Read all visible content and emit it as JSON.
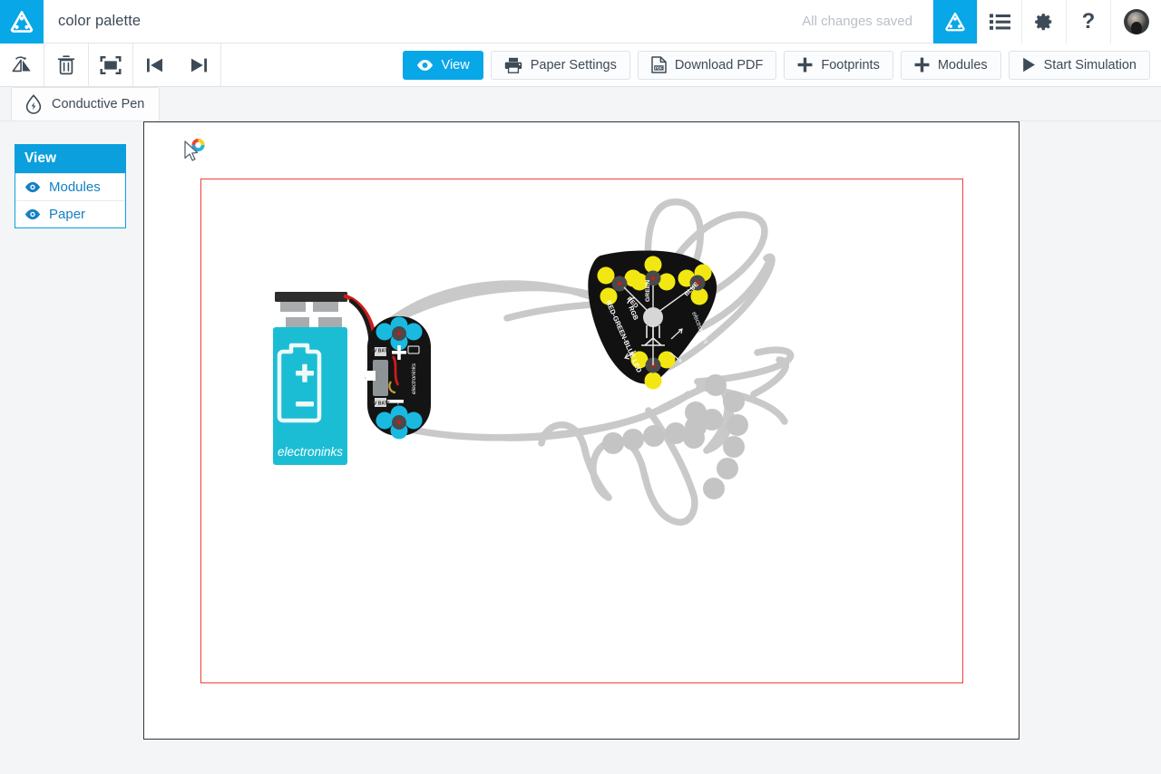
{
  "header": {
    "logo_icon": "triangle-circuit-logo-icon",
    "document_title": "color palette",
    "save_status": "All changes saved",
    "buttons": [
      {
        "name": "app-logo-button",
        "icon": "triangle-circuit-logo-icon",
        "active": true
      },
      {
        "name": "list-button",
        "icon": "list-icon",
        "active": false
      },
      {
        "name": "settings-button",
        "icon": "gear-icon",
        "active": false
      },
      {
        "name": "help-button",
        "icon": "question-mark-icon",
        "label": "?",
        "active": false
      },
      {
        "name": "account-avatar",
        "icon": "avatar-icon",
        "active": false
      }
    ]
  },
  "toolbar": {
    "icon_buttons": [
      {
        "name": "flip-button",
        "icon": "flip-horizontal-icon"
      },
      {
        "name": "delete-button",
        "icon": "trash-icon"
      },
      {
        "name": "fit-screen-button",
        "icon": "fit-to-frame-icon"
      },
      {
        "name": "step-back-button",
        "icon": "skip-previous-icon"
      },
      {
        "name": "step-forward-button",
        "icon": "skip-next-icon"
      }
    ],
    "view_label": "View",
    "view_icon": "eye-icon",
    "paper_settings_label": "Paper Settings",
    "paper_settings_icon": "printer-icon",
    "download_pdf_label": "Download PDF",
    "download_pdf_icon": "pdf-file-icon",
    "footprints_label": "Footprints",
    "footprints_icon": "plus-icon",
    "modules_label": "Modules",
    "modules_icon": "plus-icon",
    "start_simulation_label": "Start Simulation",
    "start_simulation_icon": "play-icon"
  },
  "tabs": [
    {
      "label": "Conductive Pen",
      "icon": "conductive-ink-drop-icon",
      "active": true
    }
  ],
  "view_panel": {
    "title": "View",
    "items": [
      {
        "label": "Modules",
        "icon": "eye-icon",
        "visible": true
      },
      {
        "label": "Paper",
        "icon": "eye-icon",
        "visible": true
      }
    ]
  },
  "canvas": {
    "paper_border_color": "#ef4136",
    "trace_color": "#c9c9c9",
    "footprint_pad_color": "#c4c4c4",
    "cursor_icon": "pointer-with-color-ring-icon",
    "modules": [
      {
        "name": "battery-9v",
        "brand": "electroninks",
        "symbol": "battery-plus-minus-icon",
        "body_color": "#1bbdd4"
      },
      {
        "name": "power-module",
        "brand": "electroninks",
        "body_color": "#1a1a1a",
        "pad_color": "#19b9e0",
        "labels": [
          "9V",
          "BATT",
          "+",
          "-"
        ]
      },
      {
        "name": "rgb-led-module",
        "brand": "electroninks",
        "body_color": "#111111",
        "pad_color": "#f2e712",
        "labels": [
          "RED-GREEN-BLUE LED",
          "RGB",
          "RED",
          "GREEN",
          "BLUE"
        ]
      }
    ]
  },
  "colors": {
    "accent": "#08a7e8",
    "panel_blue": "#0b9fdd",
    "text_dark": "#3d4a57",
    "muted": "#b9c0c8",
    "paper_red": "#ef4136",
    "battery_cyan": "#1bbdd4",
    "pad_yellow": "#f2e712",
    "pad_cyan": "#19b9e0",
    "trace_gray": "#c9c9c9"
  }
}
